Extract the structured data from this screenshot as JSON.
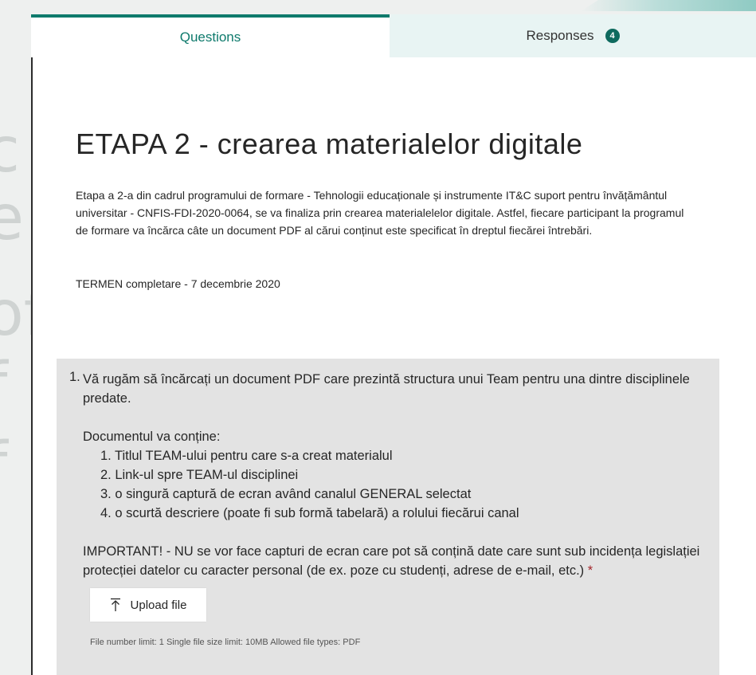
{
  "tabs": {
    "questions_label": "Questions",
    "responses_label": "Responses",
    "responses_count": "4"
  },
  "form": {
    "title": "ETAPA 2 - crearea materialelor digitale",
    "description": "Etapa a 2-a  din cadrul programului de formare - Tehnologii educaționale și instrumente IT&C suport pentru învățământul universitar - CNFIS-FDI-2020-0064, se va finaliza prin crearea materialelelor digitale. Astfel, fiecare participant la programul de formare va încărca câte un document PDF al cărui conținut este specificat în dreptul fiecărei întrebări.",
    "deadline": "TERMEN completare - 7 decembrie 2020"
  },
  "question": {
    "number": "1.",
    "intro": "Vă rugăm să încărcați un document PDF care prezintă structura unui Team pentru una dintre disciplinele predate.",
    "list_heading": "Documentul va conține:",
    "items": [
      "1. Titlul TEAM-ului pentru care s-a creat materialul",
      "2. Link-ul spre TEAM-ul disciplinei",
      "3. o singură captură de ecran având canalul GENERAL selectat",
      "4. o scurtă descriere (poate fi sub formă tabelară) a rolului fiecărui canal"
    ],
    "important": "IMPORTANT! - NU se vor face capturi de ecran care pot să conțină date care sunt sub incidența legislației protecției datelor cu caracter personal (de ex. poze cu studenți, adrese de e-mail, etc.)",
    "required_mark": "*",
    "upload_label": "Upload file",
    "limits": "File number limit: 1   Single file size limit: 10MB   Allowed file types: PDF"
  },
  "background_letters": [
    "c",
    "e",
    "of",
    "f",
    "f"
  ],
  "colors": {
    "accent": "#0e7a6c",
    "tab_inactive_bg": "#e8f4f3",
    "question_bg": "#e3e3e3",
    "required": "#a4262c"
  },
  "icons": {
    "upload": "upload-arrow-icon"
  }
}
